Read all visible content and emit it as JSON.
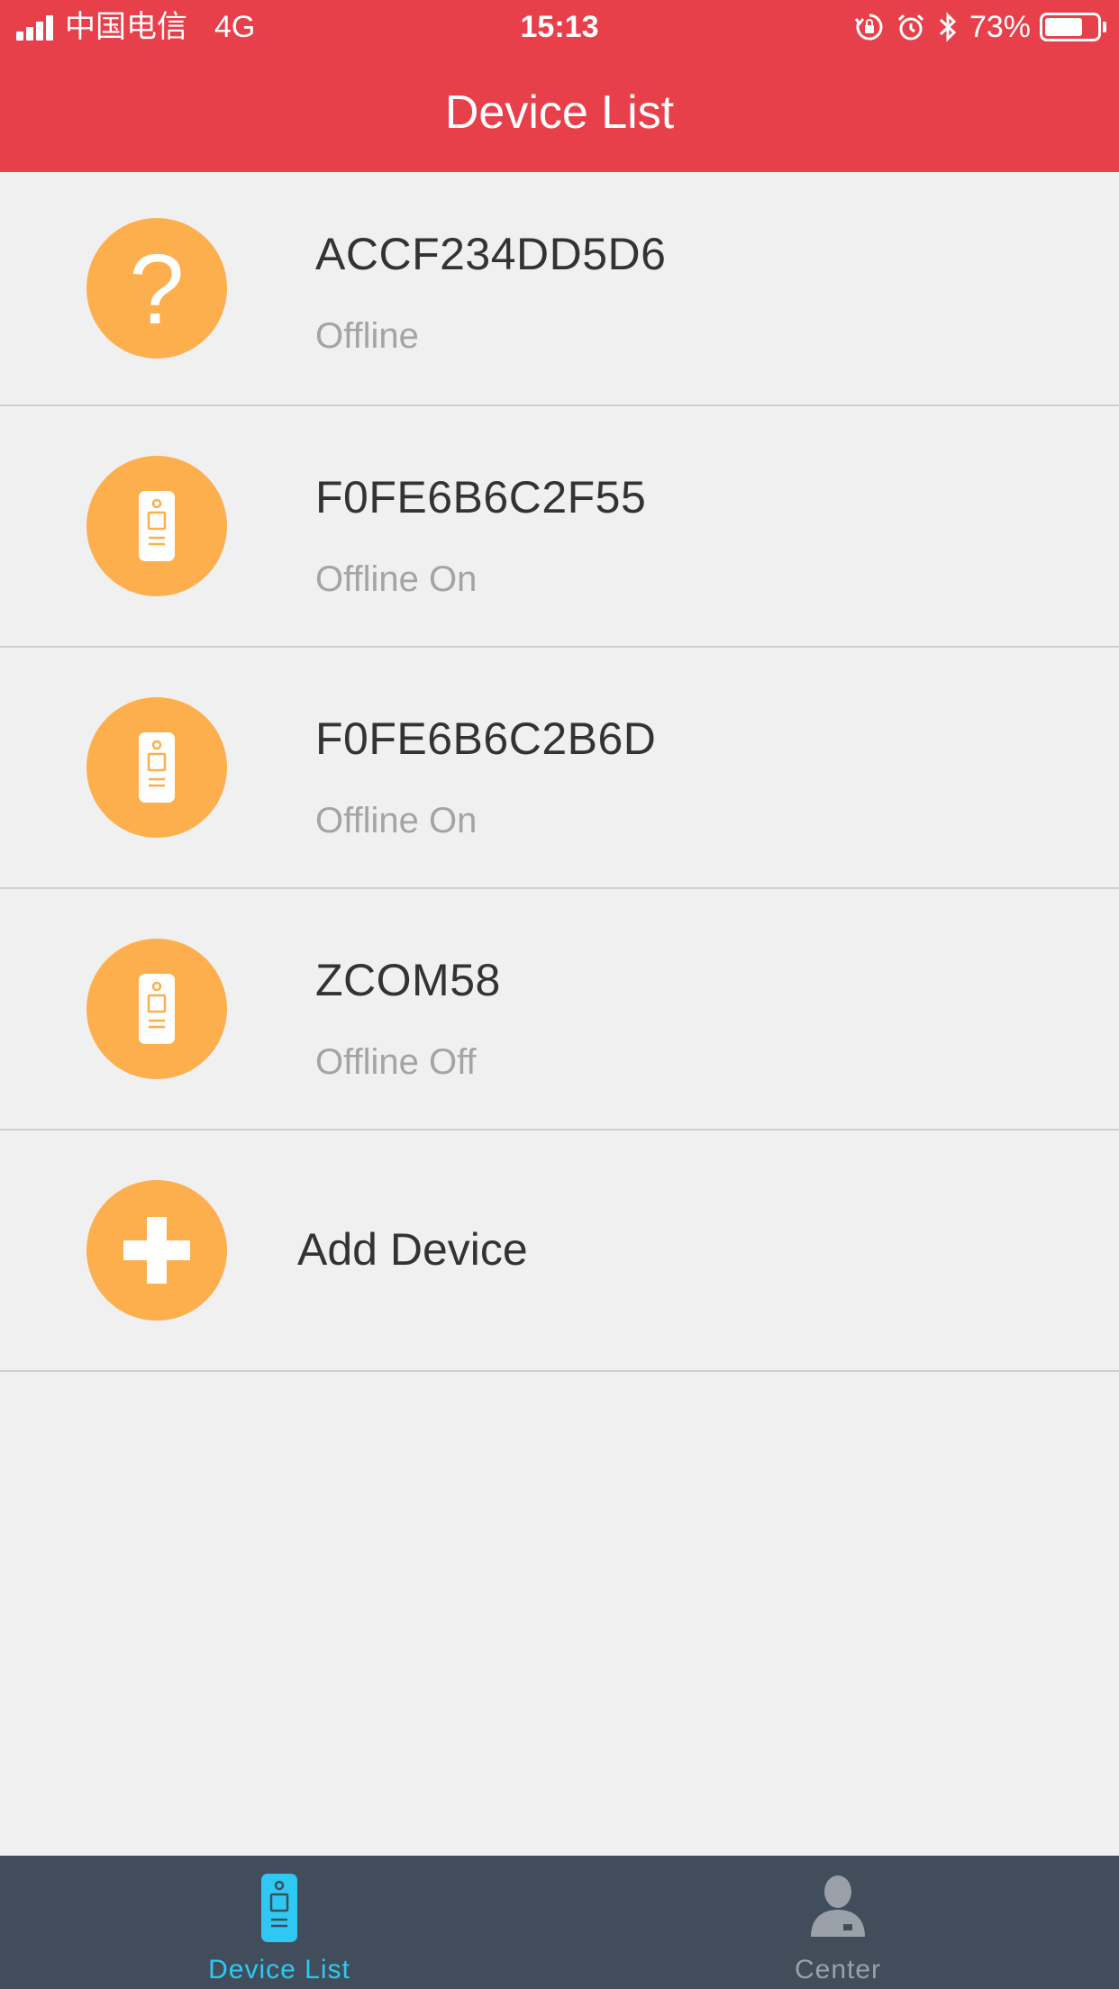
{
  "status_bar": {
    "carrier": "中国电信",
    "network": "4G",
    "time": "15:13",
    "battery": "73%",
    "battery_level": 0.73,
    "icons": [
      "signal-icon",
      "orientation-lock-icon",
      "alarm-icon",
      "bluetooth-icon",
      "battery-icon"
    ]
  },
  "header": {
    "title": "Device List"
  },
  "devices": [
    {
      "name": "ACCF234DD5D6",
      "status": "Offline",
      "icon": "question-icon"
    },
    {
      "name": "F0FE6B6C2F55",
      "status": "Offline On",
      "icon": "doorbell-icon"
    },
    {
      "name": "F0FE6B6C2B6D",
      "status": "Offline On",
      "icon": "doorbell-icon"
    },
    {
      "name": "ZCOM58",
      "status": "Offline Off",
      "icon": "doorbell-icon"
    }
  ],
  "add_device": {
    "label": "Add Device",
    "icon": "plus-icon"
  },
  "tabs": [
    {
      "label": "Device List",
      "icon": "doorbell-icon",
      "active": true
    },
    {
      "label": "Center",
      "icon": "person-icon",
      "active": false
    }
  ],
  "colors": {
    "header": "#e8404a",
    "avatar": "#fdae4d",
    "background": "#f0f0f0",
    "tabbar": "#424d5b",
    "tab_active": "#2ec8f2",
    "tab_inactive": "#9aa0a8"
  }
}
